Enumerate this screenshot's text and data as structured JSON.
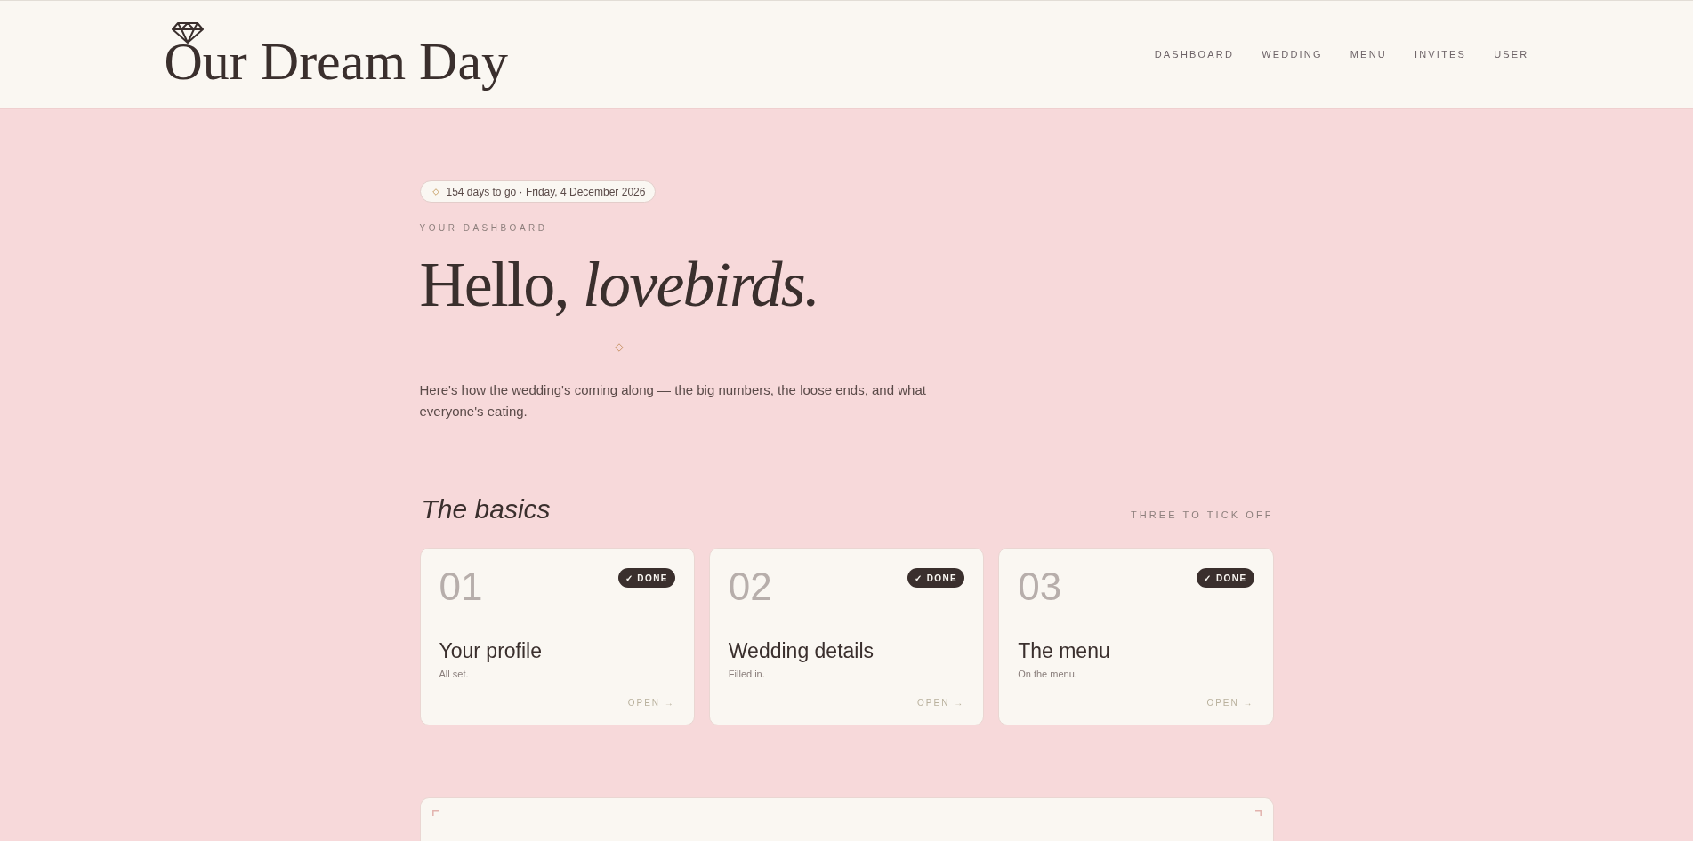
{
  "header": {
    "logo": "Our Dream Day",
    "nav": [
      "DASHBOARD",
      "WEDDING",
      "MENU",
      "INVITES",
      "USER"
    ]
  },
  "countdown": "154 days to go · Friday, 4 December 2026",
  "eyebrow": "YOUR DASHBOARD",
  "heading": "Hello, *lovebirds.*",
  "intro": "Here's how the wedding's coming along — the big numbers, the loose ends, and what everyone's eating.",
  "basics": {
    "title": "The basics",
    "caption": "THREE TO TICK OFF",
    "cards": [
      {
        "number": "01",
        "badge": "✓ DONE",
        "done": true,
        "title": "Your profile",
        "note": "All set.",
        "link": "OPEN →"
      },
      {
        "number": "02",
        "badge": "✓ DONE",
        "done": true,
        "title": "Wedding details",
        "note": "Filled in.",
        "link": "OPEN →"
      },
      {
        "number": "03",
        "badge": "✓ DONE",
        "done": true,
        "title": "The menu",
        "note": "On the menu.",
        "link": "OPEN →"
      }
    ]
  }
}
